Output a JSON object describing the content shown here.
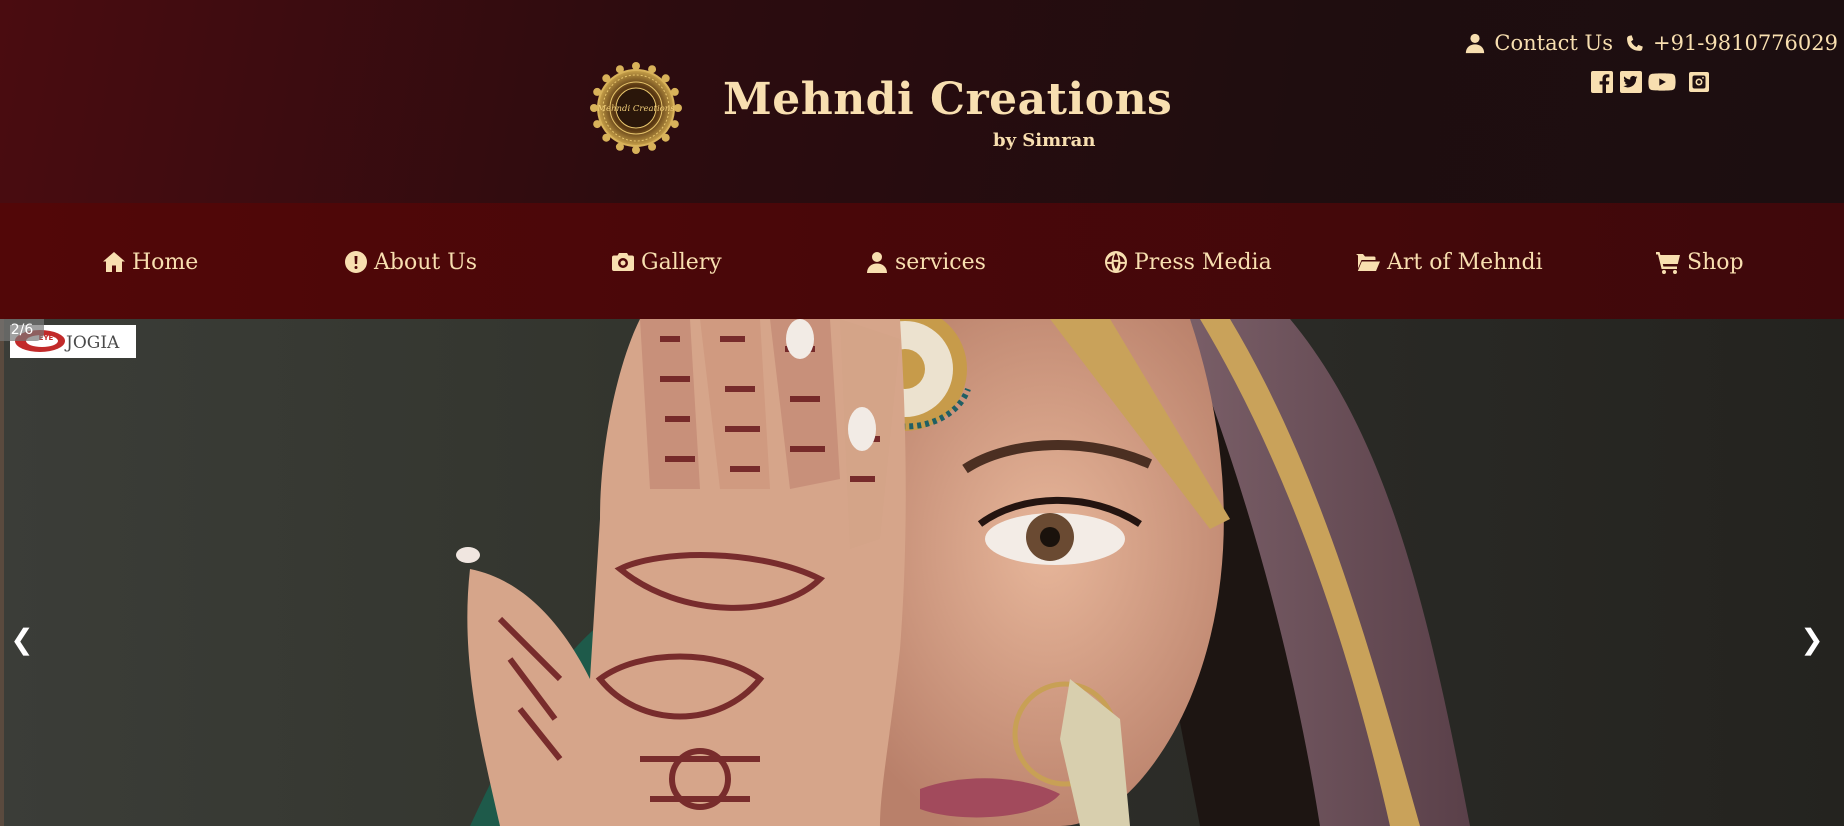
{
  "brand": {
    "title": "Mehndi Creations",
    "subtitle": "by Simran",
    "logo_text": "Mehndi Creations"
  },
  "contact": {
    "contact_label": "Contact Us",
    "phone": "+91-9810776029"
  },
  "social": [
    "facebook-icon",
    "twitter-icon",
    "youtube-icon",
    "instagram-icon"
  ],
  "nav": {
    "items": [
      {
        "label": "Home",
        "icon": "home-icon"
      },
      {
        "label": "About Us",
        "icon": "info-icon"
      },
      {
        "label": "Gallery",
        "icon": "camera-icon"
      },
      {
        "label": "services",
        "icon": "user-icon"
      },
      {
        "label": "Press Media",
        "icon": "globe-icon"
      },
      {
        "label": "Art of Mehndi",
        "icon": "folder-open-icon"
      },
      {
        "label": "Shop",
        "icon": "cart-icon"
      }
    ]
  },
  "slideshow": {
    "counter": "2/6",
    "prev_label": "❮",
    "next_label": "❯",
    "watermark_eye": "EYE",
    "watermark_text": "JOGIA"
  },
  "colors": {
    "header_bg": "#2d0c0f",
    "nav_bg": "#4a0709",
    "text_gold": "#f8dfb0"
  }
}
